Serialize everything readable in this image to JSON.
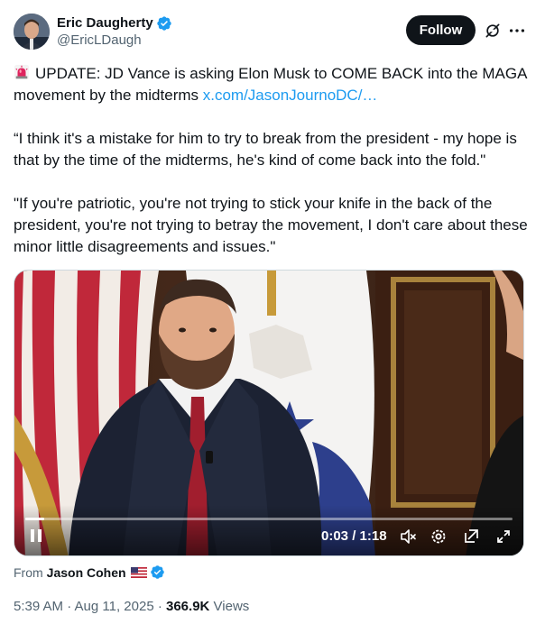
{
  "author": {
    "display_name": "Eric Daugherty",
    "handle": "@EricLDaugh",
    "verified": true
  },
  "actions": {
    "follow_label": "Follow"
  },
  "icons": {
    "verified": "verified-badge-icon",
    "grok": "grok-icon",
    "more": "more-icon",
    "siren": "siren-emoji-icon",
    "flag": "us-flag-icon"
  },
  "tweet": {
    "line1_text": "UPDATE: JD Vance is asking Elon Musk to COME BACK into the MAGA movement by the midterms ",
    "line1_link": "x.com/JasonJournoDC/…",
    "para2": "“I think it's a mistake for him to try to break from the president - my hope is that by the time of the midterms, he's kind of come back into the fold.\"",
    "para3": "\"If you're patriotic, you're not trying to stick your knife in the back of the president, you're not trying to betray the movement, I don't care about these minor little disagreements and issues.\""
  },
  "video": {
    "time_display": "0:03 / 1:18",
    "progress_fraction": 0.038,
    "icons": [
      "pause-icon",
      "mute-icon",
      "settings-icon",
      "pop-out-icon",
      "fullscreen-icon"
    ]
  },
  "source": {
    "prefix": "From",
    "name": "Jason Cohen"
  },
  "meta": {
    "timestamp": "5:39 AM · Aug 11, 2025 · ",
    "views_count": "366.9K",
    "views_label": " Views"
  },
  "colors": {
    "accent": "#1d9bf0",
    "text": "#0f1419",
    "muted": "#536471"
  }
}
